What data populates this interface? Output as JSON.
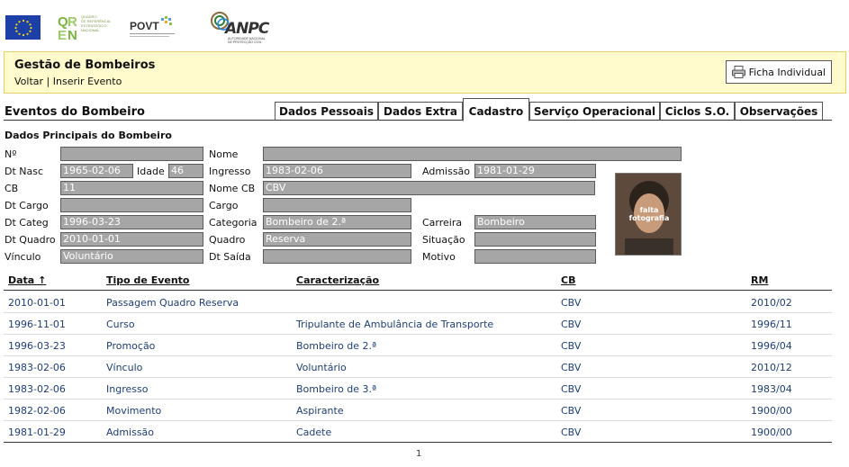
{
  "header": {
    "title": "Gestão de Bombeiros",
    "link_back": "Voltar",
    "separator": "|",
    "link_insert": "Inserir Evento",
    "ficha_button": "Ficha Individual"
  },
  "section": {
    "title": "Eventos do Bombeiro",
    "subtitle": "Dados Principais do Bombeiro"
  },
  "tabs": [
    {
      "label": "Dados Pessoais",
      "active": false
    },
    {
      "label": "Dados Extra",
      "active": false
    },
    {
      "label": "Cadastro",
      "active": true
    },
    {
      "label": "Serviço Operacional",
      "active": false
    },
    {
      "label": "Ciclos S.O.",
      "active": false
    },
    {
      "label": "Observações",
      "active": false
    }
  ],
  "form": {
    "labels": {
      "numero": "Nº",
      "nome": "Nome",
      "dt_nasc": "Dt Nasc",
      "idade": "Idade",
      "ingresso": "Ingresso",
      "admissao": "Admissão",
      "cb": "CB",
      "nome_cb": "Nome CB",
      "dt_cargo": "Dt Cargo",
      "cargo": "Cargo",
      "dt_categ": "Dt Categ",
      "categoria": "Categoria",
      "carreira": "Carreira",
      "dt_quadro": "Dt Quadro",
      "quadro": "Quadro",
      "situacao": "Situação",
      "vinculo": "Vínculo",
      "dt_saida": "Dt Saída",
      "motivo": "Motivo"
    },
    "values": {
      "numero": "",
      "nome": "",
      "dt_nasc": "1965-02-06",
      "idade": "46",
      "ingresso": "1983-02-06",
      "admissao": "1981-01-29",
      "cb": "11",
      "nome_cb": "CBV",
      "dt_cargo": "",
      "cargo": "",
      "dt_categ": "1996-03-23",
      "categoria": "Bombeiro de 2.ª",
      "carreira": "Bombeiro",
      "dt_quadro": "2010-01-01",
      "quadro": "Reserva",
      "situacao": "",
      "vinculo": "Voluntário",
      "dt_saida": "",
      "motivo": ""
    },
    "photo_text": [
      "falta",
      "fotografia"
    ]
  },
  "logos": {
    "qren_lines": [
      "QUADRO",
      "DE REFERÊNCIA",
      "ESTRATÉGICO",
      "NACIONAL"
    ],
    "povt": "POVT",
    "anpc": "ANPC",
    "anpc_sub": [
      "AUTORIDADE NACIONAL",
      "DE PROTECÇÃO CIVIL"
    ]
  },
  "table": {
    "columns": [
      "Data ↑",
      "Tipo de Evento",
      "Caracterização",
      "CB",
      "RM"
    ],
    "rows": [
      [
        "2010-01-01",
        "Passagem Quadro Reserva",
        "",
        "CBV",
        "2010/02"
      ],
      [
        "1996-11-01",
        "Curso",
        "Tripulante de Ambulância de Transporte",
        "CBV",
        "1996/11"
      ],
      [
        "1996-03-23",
        "Promoção",
        "Bombeiro de 2.ª",
        "CBV",
        "1996/04"
      ],
      [
        "1983-02-06",
        "Vínculo",
        "Voluntário",
        "CBV",
        "2010/12"
      ],
      [
        "1983-02-06",
        "Ingresso",
        "Bombeiro de 3.ª",
        "CBV",
        "1983/04"
      ],
      [
        "1982-02-06",
        "Movimento",
        "Aspirante",
        "CBV",
        "1900/00"
      ],
      [
        "1981-01-29",
        "Admissão",
        "Cadete",
        "CBV",
        "1900/00"
      ]
    ],
    "page": "1"
  }
}
